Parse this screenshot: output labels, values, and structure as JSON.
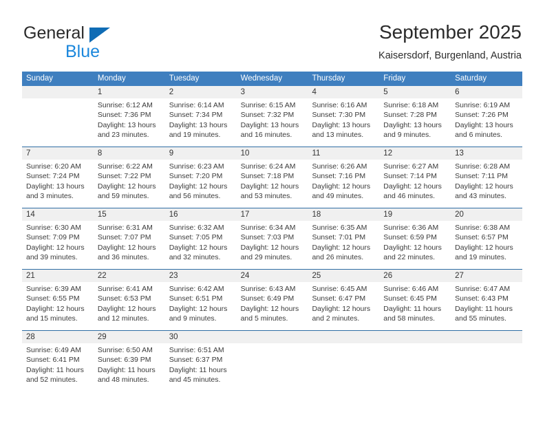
{
  "brand": {
    "line1": "General",
    "line2": "Blue",
    "triangle_color": "#0f6cb5",
    "line2_color": "#1b87dc"
  },
  "header": {
    "title": "September 2025",
    "subtitle": "Kaisersdorf, Burgenland, Austria"
  },
  "colors": {
    "header_bar": "#3f7fbf",
    "week_separator": "#2e6da4",
    "daynum_band": "#f0f0f0"
  },
  "calendar": {
    "weekdays": [
      "Sunday",
      "Monday",
      "Tuesday",
      "Wednesday",
      "Thursday",
      "Friday",
      "Saturday"
    ],
    "weeks": [
      [
        {
          "day": "",
          "lines": []
        },
        {
          "day": "1",
          "lines": [
            "Sunrise: 6:12 AM",
            "Sunset: 7:36 PM",
            "Daylight: 13 hours",
            "and 23 minutes."
          ]
        },
        {
          "day": "2",
          "lines": [
            "Sunrise: 6:14 AM",
            "Sunset: 7:34 PM",
            "Daylight: 13 hours",
            "and 19 minutes."
          ]
        },
        {
          "day": "3",
          "lines": [
            "Sunrise: 6:15 AM",
            "Sunset: 7:32 PM",
            "Daylight: 13 hours",
            "and 16 minutes."
          ]
        },
        {
          "day": "4",
          "lines": [
            "Sunrise: 6:16 AM",
            "Sunset: 7:30 PM",
            "Daylight: 13 hours",
            "and 13 minutes."
          ]
        },
        {
          "day": "5",
          "lines": [
            "Sunrise: 6:18 AM",
            "Sunset: 7:28 PM",
            "Daylight: 13 hours",
            "and 9 minutes."
          ]
        },
        {
          "day": "6",
          "lines": [
            "Sunrise: 6:19 AM",
            "Sunset: 7:26 PM",
            "Daylight: 13 hours",
            "and 6 minutes."
          ]
        }
      ],
      [
        {
          "day": "7",
          "lines": [
            "Sunrise: 6:20 AM",
            "Sunset: 7:24 PM",
            "Daylight: 13 hours",
            "and 3 minutes."
          ]
        },
        {
          "day": "8",
          "lines": [
            "Sunrise: 6:22 AM",
            "Sunset: 7:22 PM",
            "Daylight: 12 hours",
            "and 59 minutes."
          ]
        },
        {
          "day": "9",
          "lines": [
            "Sunrise: 6:23 AM",
            "Sunset: 7:20 PM",
            "Daylight: 12 hours",
            "and 56 minutes."
          ]
        },
        {
          "day": "10",
          "lines": [
            "Sunrise: 6:24 AM",
            "Sunset: 7:18 PM",
            "Daylight: 12 hours",
            "and 53 minutes."
          ]
        },
        {
          "day": "11",
          "lines": [
            "Sunrise: 6:26 AM",
            "Sunset: 7:16 PM",
            "Daylight: 12 hours",
            "and 49 minutes."
          ]
        },
        {
          "day": "12",
          "lines": [
            "Sunrise: 6:27 AM",
            "Sunset: 7:14 PM",
            "Daylight: 12 hours",
            "and 46 minutes."
          ]
        },
        {
          "day": "13",
          "lines": [
            "Sunrise: 6:28 AM",
            "Sunset: 7:11 PM",
            "Daylight: 12 hours",
            "and 43 minutes."
          ]
        }
      ],
      [
        {
          "day": "14",
          "lines": [
            "Sunrise: 6:30 AM",
            "Sunset: 7:09 PM",
            "Daylight: 12 hours",
            "and 39 minutes."
          ]
        },
        {
          "day": "15",
          "lines": [
            "Sunrise: 6:31 AM",
            "Sunset: 7:07 PM",
            "Daylight: 12 hours",
            "and 36 minutes."
          ]
        },
        {
          "day": "16",
          "lines": [
            "Sunrise: 6:32 AM",
            "Sunset: 7:05 PM",
            "Daylight: 12 hours",
            "and 32 minutes."
          ]
        },
        {
          "day": "17",
          "lines": [
            "Sunrise: 6:34 AM",
            "Sunset: 7:03 PM",
            "Daylight: 12 hours",
            "and 29 minutes."
          ]
        },
        {
          "day": "18",
          "lines": [
            "Sunrise: 6:35 AM",
            "Sunset: 7:01 PM",
            "Daylight: 12 hours",
            "and 26 minutes."
          ]
        },
        {
          "day": "19",
          "lines": [
            "Sunrise: 6:36 AM",
            "Sunset: 6:59 PM",
            "Daylight: 12 hours",
            "and 22 minutes."
          ]
        },
        {
          "day": "20",
          "lines": [
            "Sunrise: 6:38 AM",
            "Sunset: 6:57 PM",
            "Daylight: 12 hours",
            "and 19 minutes."
          ]
        }
      ],
      [
        {
          "day": "21",
          "lines": [
            "Sunrise: 6:39 AM",
            "Sunset: 6:55 PM",
            "Daylight: 12 hours",
            "and 15 minutes."
          ]
        },
        {
          "day": "22",
          "lines": [
            "Sunrise: 6:41 AM",
            "Sunset: 6:53 PM",
            "Daylight: 12 hours",
            "and 12 minutes."
          ]
        },
        {
          "day": "23",
          "lines": [
            "Sunrise: 6:42 AM",
            "Sunset: 6:51 PM",
            "Daylight: 12 hours",
            "and 9 minutes."
          ]
        },
        {
          "day": "24",
          "lines": [
            "Sunrise: 6:43 AM",
            "Sunset: 6:49 PM",
            "Daylight: 12 hours",
            "and 5 minutes."
          ]
        },
        {
          "day": "25",
          "lines": [
            "Sunrise: 6:45 AM",
            "Sunset: 6:47 PM",
            "Daylight: 12 hours",
            "and 2 minutes."
          ]
        },
        {
          "day": "26",
          "lines": [
            "Sunrise: 6:46 AM",
            "Sunset: 6:45 PM",
            "Daylight: 11 hours",
            "and 58 minutes."
          ]
        },
        {
          "day": "27",
          "lines": [
            "Sunrise: 6:47 AM",
            "Sunset: 6:43 PM",
            "Daylight: 11 hours",
            "and 55 minutes."
          ]
        }
      ],
      [
        {
          "day": "28",
          "lines": [
            "Sunrise: 6:49 AM",
            "Sunset: 6:41 PM",
            "Daylight: 11 hours",
            "and 52 minutes."
          ]
        },
        {
          "day": "29",
          "lines": [
            "Sunrise: 6:50 AM",
            "Sunset: 6:39 PM",
            "Daylight: 11 hours",
            "and 48 minutes."
          ]
        },
        {
          "day": "30",
          "lines": [
            "Sunrise: 6:51 AM",
            "Sunset: 6:37 PM",
            "Daylight: 11 hours",
            "and 45 minutes."
          ]
        },
        {
          "day": "",
          "lines": []
        },
        {
          "day": "",
          "lines": []
        },
        {
          "day": "",
          "lines": []
        },
        {
          "day": "",
          "lines": []
        }
      ]
    ]
  }
}
